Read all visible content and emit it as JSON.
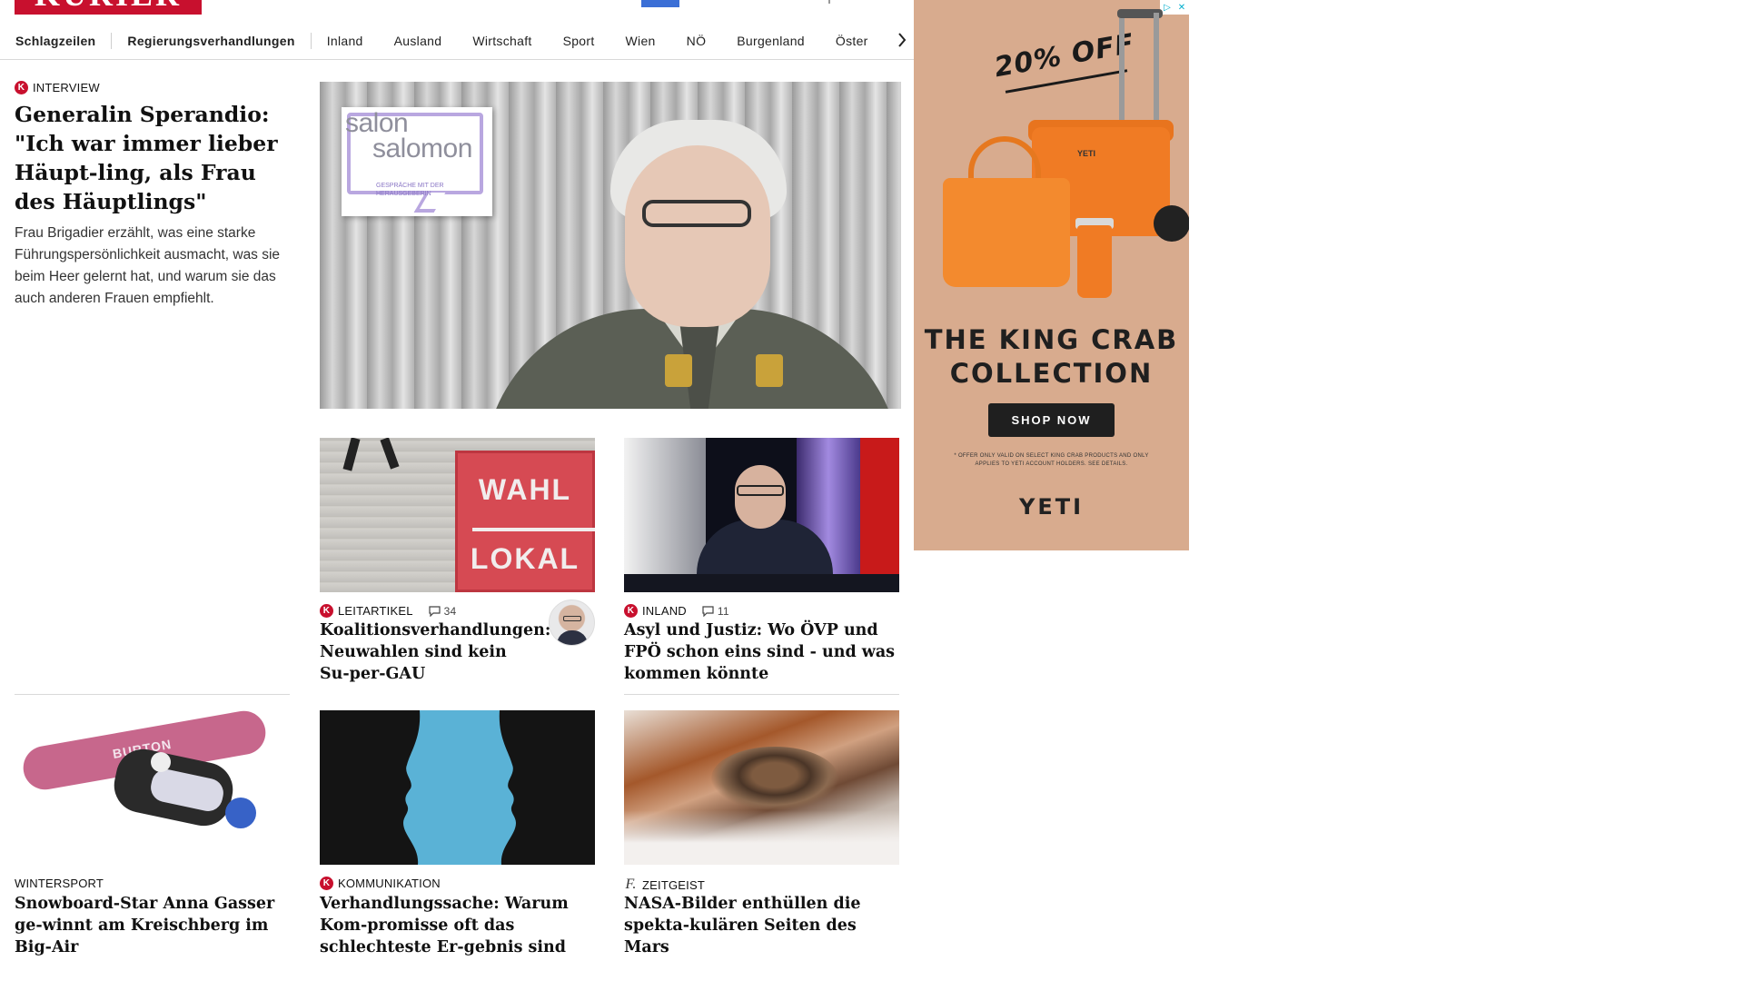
{
  "header": {
    "logo_text": "KURIER",
    "brand_color": "#c8102e"
  },
  "nav": {
    "items": [
      "Schlagzeilen",
      "Regierungsverhandlungen",
      "Inland",
      "Ausland",
      "Wirtschaft",
      "Sport",
      "Wien",
      "NÖ",
      "Burgenland",
      "Öster"
    ],
    "more_icon": "chevron-right-icon"
  },
  "lead": {
    "kicker": "INTERVIEW",
    "badge": "K",
    "headline": "Generalin Sperandio: \"Ich war immer lieber Häupt-ling, als Frau des Häuptlings\"",
    "teaser": "Frau Brigadier erzählt, was eine starke Führungspersönlichkeit ausmacht, was sie beim Heer gelernt hat, und warum sie das auch anderen Frauen empfiehlt.",
    "image_overlay": {
      "line1": "salon",
      "line2": "salomon",
      "subtitle": "GESPRÄCHE MIT DER HERAUSGEBERIN"
    }
  },
  "articles": [
    {
      "kicker": "LEITARTIKEL",
      "badge": "K",
      "comments": "34",
      "headline": "Koalitionsverhandlungen: Neuwahlen sind kein Su-per-GAU",
      "image_text": [
        "WAHL",
        "LOKAL"
      ]
    },
    {
      "kicker": "INLAND",
      "badge": "K",
      "comments": "11",
      "headline": "Asyl und Justiz: Wo ÖVP und FPÖ schon eins sind - und was kommen könnte"
    },
    {
      "kicker": "WINTERSPORT",
      "headline": "Snowboard-Star Anna Gasser ge-winnt am Kreischberg im Big-Air",
      "image_text": "BURTON"
    },
    {
      "kicker": "KOMMUNIKATION",
      "badge": "K",
      "headline": "Verhandlungssache: Warum Kom-promisse oft das schlechteste Er-gebnis sind"
    },
    {
      "kicker": "ZEITGEIST",
      "badge": "f.",
      "headline": "NASA-Bilder enthüllen die spekta-kulären Seiten des Mars"
    }
  ],
  "ad": {
    "discount": "20% OFF",
    "headline_line1": "THE KING CRAB",
    "headline_line2": "COLLECTION",
    "cta": "SHOP NOW",
    "fine_print": "* OFFER ONLY VALID ON SELECT KING CRAB PRODUCTS AND ONLY APPLIES TO YETI ACCOUNT HOLDERS. SEE DETAILS.",
    "brand": "YETI",
    "cooler_label": "YETI",
    "ad_choices": [
      "▷",
      "✕"
    ],
    "background_color": "#d8ab8e"
  }
}
